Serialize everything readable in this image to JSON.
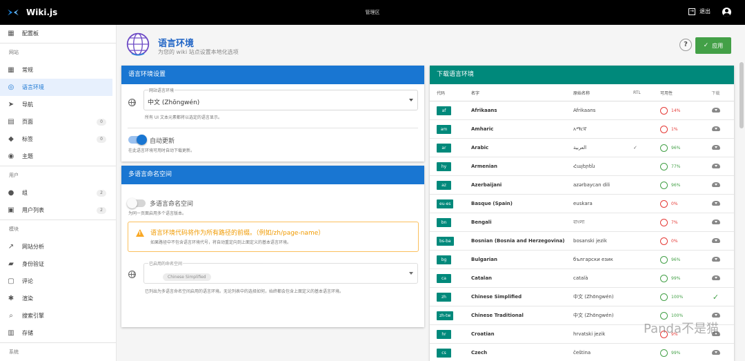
{
  "topbar": {
    "app_name": "Wiki.js",
    "center_title": "管理区",
    "logout_label": "退出"
  },
  "sidebar": {
    "items": [
      {
        "label": "配置板",
        "icon": "dashboard-icon"
      },
      {
        "label": "常规",
        "icon": "grid-icon"
      },
      {
        "label": "语言环境",
        "icon": "globe-icon",
        "active": true
      },
      {
        "label": "导航",
        "icon": "navigation-icon"
      },
      {
        "label": "页面",
        "icon": "page-icon",
        "count": "0"
      },
      {
        "label": "标签",
        "icon": "tag-icon",
        "count": "0"
      },
      {
        "label": "主题",
        "icon": "palette-icon"
      },
      {
        "label": "组",
        "icon": "users-icon",
        "count": "2"
      },
      {
        "label": "用户列表",
        "icon": "user-card-icon",
        "count": "2"
      },
      {
        "label": "网站分析",
        "icon": "analytics-icon"
      },
      {
        "label": "身份验证",
        "icon": "lock-icon"
      },
      {
        "label": "评论",
        "icon": "comment-icon"
      },
      {
        "label": "渲染",
        "icon": "settings-icon"
      },
      {
        "label": "搜索引擎",
        "icon": "search-icon"
      },
      {
        "label": "存储",
        "icon": "storage-icon"
      }
    ],
    "sections": {
      "site": "网站",
      "users": "用户",
      "modules": "模块",
      "system": "系统"
    }
  },
  "page": {
    "title": "语言环境",
    "subtitle": "为您的 wiki 站点设置本地化选项",
    "help_label": "?",
    "apply_label": "应用"
  },
  "locale_settings": {
    "header": "语言环境设置",
    "site_locale_label": "网站语言环境",
    "site_locale_value": "中文 (Zhōngwén)",
    "site_locale_note": "所有 UI 文本元素都将以选定的语言显示。",
    "auto_update_label": "自动更新",
    "auto_update_note": "在此语言环境可用时自动下载更新。"
  },
  "namespaces": {
    "header": "多语言命名空间",
    "toggle_label": "多语言命名空间",
    "toggle_note": "为同一页面启用多个语言版本。",
    "warning_title": "语言环境代码将作为所有路径的前缀。（例如/zh/page-name）",
    "warning_note": "如果路径中不包含语言环境代号，将自动重定向到上面定义的基本语言环境。",
    "enabled_label": "已启用的命名空间",
    "chip": "Chinese Simplified",
    "enabled_note": "已列出为多语言命名空间启用的语言环境。无论列表中的选择如何，始终都会包含上面定义的基本语言环境。"
  },
  "download_locales": {
    "header": "下载语言环境",
    "columns": [
      "代码",
      "名字",
      "原始名称",
      "RTL",
      "可用性",
      "下载"
    ],
    "rows": [
      {
        "code": "af",
        "name": "Afrikaans",
        "native": "Afrikaans",
        "rtl": "",
        "availability": "14%",
        "status": "download"
      },
      {
        "code": "am",
        "name": "Amharic",
        "native": "አማርኛ",
        "rtl": "",
        "availability": "1%",
        "status": "download"
      },
      {
        "code": "ar",
        "name": "Arabic",
        "native": "العربية",
        "rtl": "✓",
        "availability": "96%",
        "status": "download"
      },
      {
        "code": "hy",
        "name": "Armenian",
        "native": "Հայերեն",
        "rtl": "",
        "availability": "77%",
        "status": "download"
      },
      {
        "code": "az",
        "name": "Azerbaijani",
        "native": "azərbaycan dili",
        "rtl": "",
        "availability": "96%",
        "status": "download"
      },
      {
        "code": "eu-es",
        "name": "Basque (Spain)",
        "native": "euskara",
        "rtl": "",
        "availability": "0%",
        "status": "download"
      },
      {
        "code": "bn",
        "name": "Bengali",
        "native": "বাংলা",
        "rtl": "",
        "availability": "7%",
        "status": "download"
      },
      {
        "code": "bs-ba",
        "name": "Bosnian (Bosnia and Herzegovina)",
        "native": "bosanski jezik",
        "rtl": "",
        "availability": "0%",
        "status": "download"
      },
      {
        "code": "bg",
        "name": "Bulgarian",
        "native": "български език",
        "rtl": "",
        "availability": "96%",
        "status": "download"
      },
      {
        "code": "ca",
        "name": "Catalan",
        "native": "català",
        "rtl": "",
        "availability": "99%",
        "status": "download"
      },
      {
        "code": "zh",
        "name": "Chinese Simplified",
        "native": "中文 (Zhōngwén)",
        "rtl": "",
        "availability": "100%",
        "status": "installed"
      },
      {
        "code": "zh-tw",
        "name": "Chinese Traditional",
        "native": "中文 (Zhōngwén)",
        "rtl": "",
        "availability": "100%",
        "status": "download"
      },
      {
        "code": "hr",
        "name": "Croatian",
        "native": "hrvatski jezik",
        "rtl": "",
        "availability": "9%",
        "status": "download"
      },
      {
        "code": "cs",
        "name": "Czech",
        "native": "čeština",
        "rtl": "",
        "availability": "99%",
        "status": "download"
      }
    ]
  },
  "watermark": "Panda不是猫",
  "colors": {
    "blue": "#1976d2",
    "teal": "#00897b",
    "green": "#43a047",
    "red": "#e53935",
    "warning": "#f9a825"
  }
}
